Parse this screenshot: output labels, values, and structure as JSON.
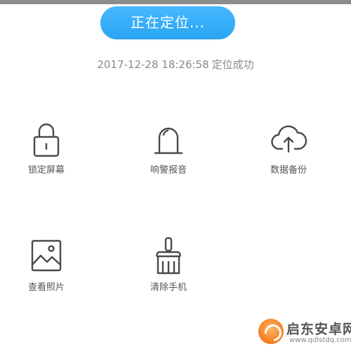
{
  "header": {
    "locate_button_label": "正在定位..."
  },
  "status": {
    "timestamp": "2017-12-28 18:26:58",
    "message": "定位成功"
  },
  "actions": [
    {
      "label": "锁定屏幕",
      "icon": "lock-icon"
    },
    {
      "label": "响警报音",
      "icon": "alarm-bell-icon"
    },
    {
      "label": "数据备份",
      "icon": "cloud-upload-icon"
    },
    {
      "label": "查看照片",
      "icon": "photo-icon"
    },
    {
      "label": "清除手机",
      "icon": "broom-icon"
    }
  ],
  "watermark": {
    "title": "启东安卓网",
    "site": "www.qdlstdq.com"
  },
  "colors": {
    "accent": "#33aaf5",
    "icon_stroke": "#4a4a4a",
    "status_text": "#8a8a8a",
    "watermark_orange": "#f57a1c"
  }
}
